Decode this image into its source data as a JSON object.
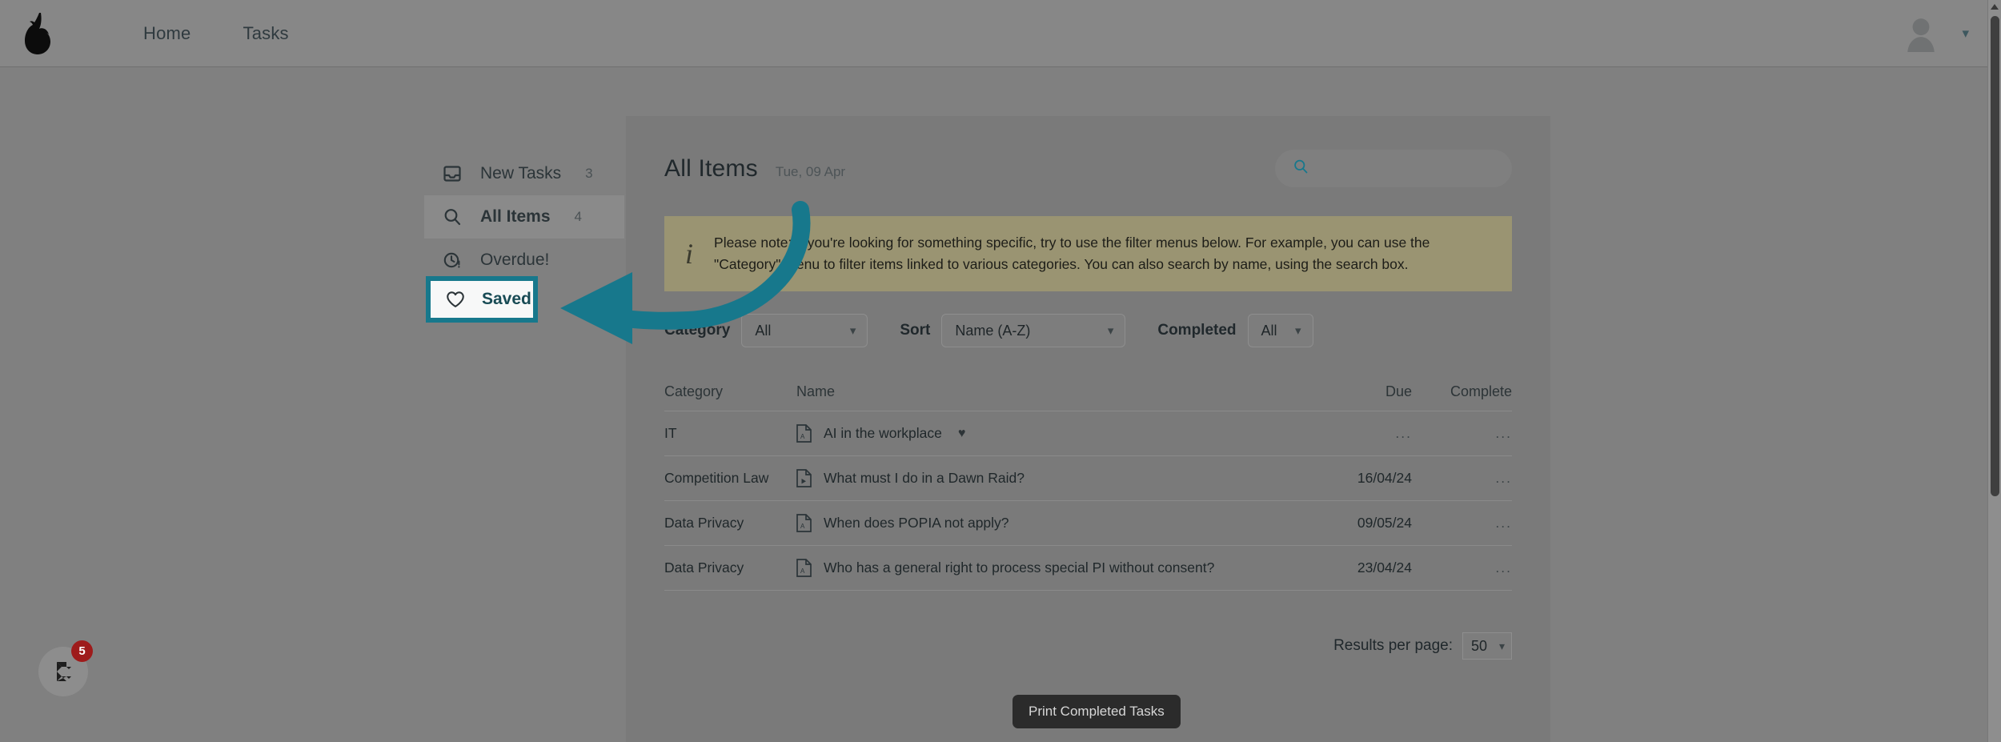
{
  "topbar": {
    "logo_icon": "pear-logo-icon",
    "links": [
      {
        "label": "Home"
      },
      {
        "label": "Tasks"
      }
    ],
    "avatar_icon": "avatar-icon",
    "caret_icon": "chevron-down-icon"
  },
  "sidebar": {
    "items": [
      {
        "label": "New Tasks",
        "count": "3",
        "icon": "inbox-icon",
        "active": false
      },
      {
        "label": "All Items",
        "count": "4",
        "icon": "search-icon",
        "active": true
      },
      {
        "label": "Overdue!",
        "count": "",
        "icon": "clock-alert-icon",
        "active": false
      },
      {
        "label": "Saved",
        "count": "",
        "icon": "heart-outline-icon",
        "active": false
      }
    ]
  },
  "panel": {
    "title": "All Items",
    "date": "Tue, 09 Apr",
    "search": {
      "value": "",
      "placeholder": "",
      "icon": "search-icon"
    },
    "notice": {
      "icon": "info-icon",
      "text": "Please note: If you're looking for something specific, try to use the filter menus below. For example, you can use the \"Category\" menu to filter items linked to various categories. You can also search by name, using the search box."
    },
    "filters": [
      {
        "label": "Category",
        "value": "All",
        "name": "category-filter"
      },
      {
        "label": "Sort",
        "value": "Name (A-Z)",
        "name": "sort-filter"
      },
      {
        "label": "Completed",
        "value": "All",
        "name": "completed-filter"
      }
    ],
    "table": {
      "headers": {
        "category": "Category",
        "name": "Name",
        "due": "Due",
        "complete": "Complete"
      },
      "rows": [
        {
          "category": "IT",
          "name": "AI in the workplace",
          "due": "...",
          "complete": "...",
          "doc_icon": "pdf-document-icon",
          "saved": true
        },
        {
          "category": "Competition Law",
          "name": "What must I do in a Dawn Raid?",
          "due": "16/04/24",
          "complete": "...",
          "doc_icon": "video-document-icon",
          "saved": false
        },
        {
          "category": "Data Privacy",
          "name": "When does POPIA not apply?",
          "due": "09/05/24",
          "complete": "...",
          "doc_icon": "pdf-document-icon",
          "saved": false
        },
        {
          "category": "Data Privacy",
          "name": "Who has a general right to process special PI without consent?",
          "due": "23/04/24",
          "complete": "...",
          "doc_icon": "pdf-document-icon",
          "saved": false
        }
      ]
    },
    "results_per_page": {
      "label": "Results per page:",
      "value": "50"
    }
  },
  "tooltip": {
    "text": "Print Completed Tasks"
  },
  "chat_widget": {
    "badge": "5",
    "icon": "chat-logo-icon"
  },
  "annotation": {
    "arrow_color": "#17788c",
    "highlight_color": "#17788c",
    "target": "Saved"
  },
  "colors": {
    "page_overlay": "#808080",
    "panel": "#7a7a7a",
    "topbar": "#878787",
    "notice_bg": "#9a9472",
    "accent_teal": "#17788c",
    "badge_red": "#9e1b1b"
  }
}
